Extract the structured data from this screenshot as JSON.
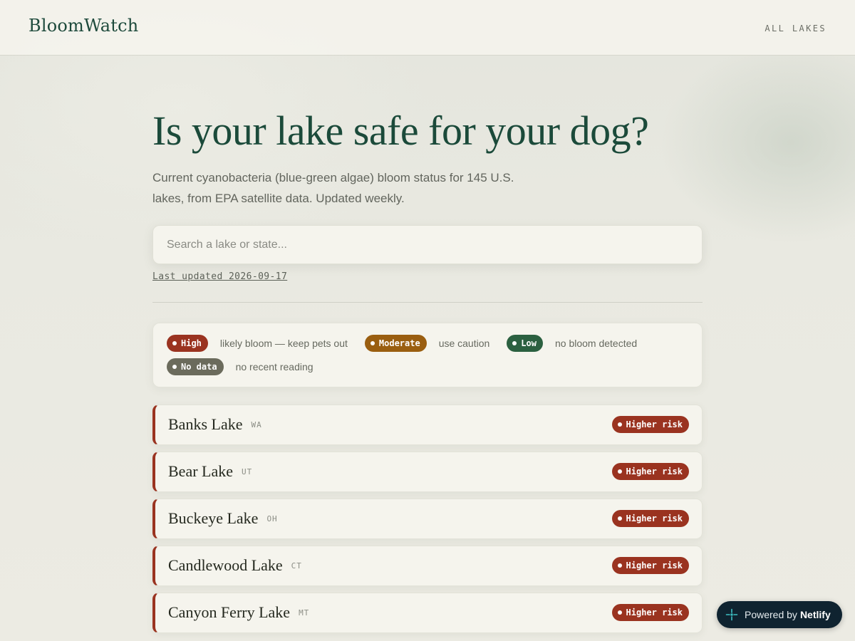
{
  "header": {
    "brand": "BloomWatch",
    "nav_all_lakes": "ALL LAKES"
  },
  "hero": {
    "title": "Is your lake safe for your dog?",
    "subtitle": "Current cyanobacteria (blue-green algae) bloom status for 145 U.S. lakes, from EPA satellite data. Updated weekly."
  },
  "search": {
    "placeholder": "Search a lake or state..."
  },
  "last_updated": "Last updated 2026-09-17",
  "legend": [
    {
      "label": "High",
      "description": "likely bloom — keep pets out",
      "color": "#9a3320"
    },
    {
      "label": "Moderate",
      "description": "use caution",
      "color": "#9a5e10"
    },
    {
      "label": "Low",
      "description": "no bloom detected",
      "color": "#2b6040"
    },
    {
      "label": "No data",
      "description": "no recent reading",
      "color": "#6b6b5c"
    }
  ],
  "lakes": [
    {
      "name": "Banks Lake",
      "state": "WA",
      "status": "Higher risk"
    },
    {
      "name": "Bear Lake",
      "state": "UT",
      "status": "Higher risk"
    },
    {
      "name": "Buckeye Lake",
      "state": "OH",
      "status": "Higher risk"
    },
    {
      "name": "Candlewood Lake",
      "state": "CT",
      "status": "Higher risk"
    },
    {
      "name": "Canyon Ferry Lake",
      "state": "MT",
      "status": "Higher risk"
    }
  ],
  "risk_color": "#9a3320",
  "badge": {
    "prefix": "Powered by",
    "brand": "Netlify",
    "icon": "netlify-icon"
  }
}
